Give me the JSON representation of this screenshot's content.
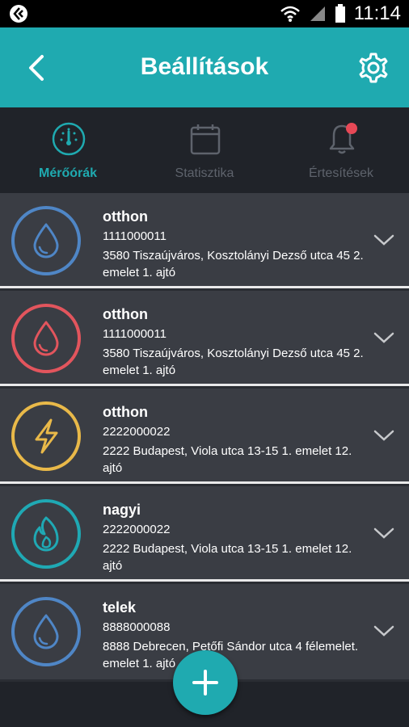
{
  "status": {
    "time": "11:14"
  },
  "header": {
    "title": "Beállítások"
  },
  "tabs": [
    {
      "label": "Mérőórák",
      "icon": "gauge-icon",
      "active": true
    },
    {
      "label": "Statisztika",
      "icon": "calendar-icon",
      "active": false
    },
    {
      "label": "Értesítések",
      "icon": "bell-icon",
      "active": false
    }
  ],
  "meters": [
    {
      "name": "otthon",
      "number": "1111000011",
      "address": "3580 Tiszaújváros, Kosztolányi Dezső utca 45 2. emelet 1. ajtó",
      "type": "water",
      "color": "#4f86c6"
    },
    {
      "name": "otthon",
      "number": "1111000011",
      "address": "3580 Tiszaújváros, Kosztolányi Dezső utca 45 2. emelet 1. ajtó",
      "type": "hot-water",
      "color": "#e2555d"
    },
    {
      "name": "otthon",
      "number": "2222000022",
      "address": "2222 Budapest, Viola utca 13-15 1. emelet 12. ajtó",
      "type": "electricity",
      "color": "#e9b949"
    },
    {
      "name": "nagyi",
      "number": "2222000022",
      "address": "2222 Budapest, Viola utca 13-15 1. emelet 12. ajtó",
      "type": "gas",
      "color": "#1fa9b4"
    },
    {
      "name": "telek",
      "number": "8888000088",
      "address": "8888 Debrecen, Petőfi Sándor utca 4 félemelet. emelet 1. ajtó",
      "type": "water",
      "color": "#4f86c6"
    }
  ],
  "colors": {
    "accent": "#1faab0",
    "notification_dot": "#e74856"
  }
}
